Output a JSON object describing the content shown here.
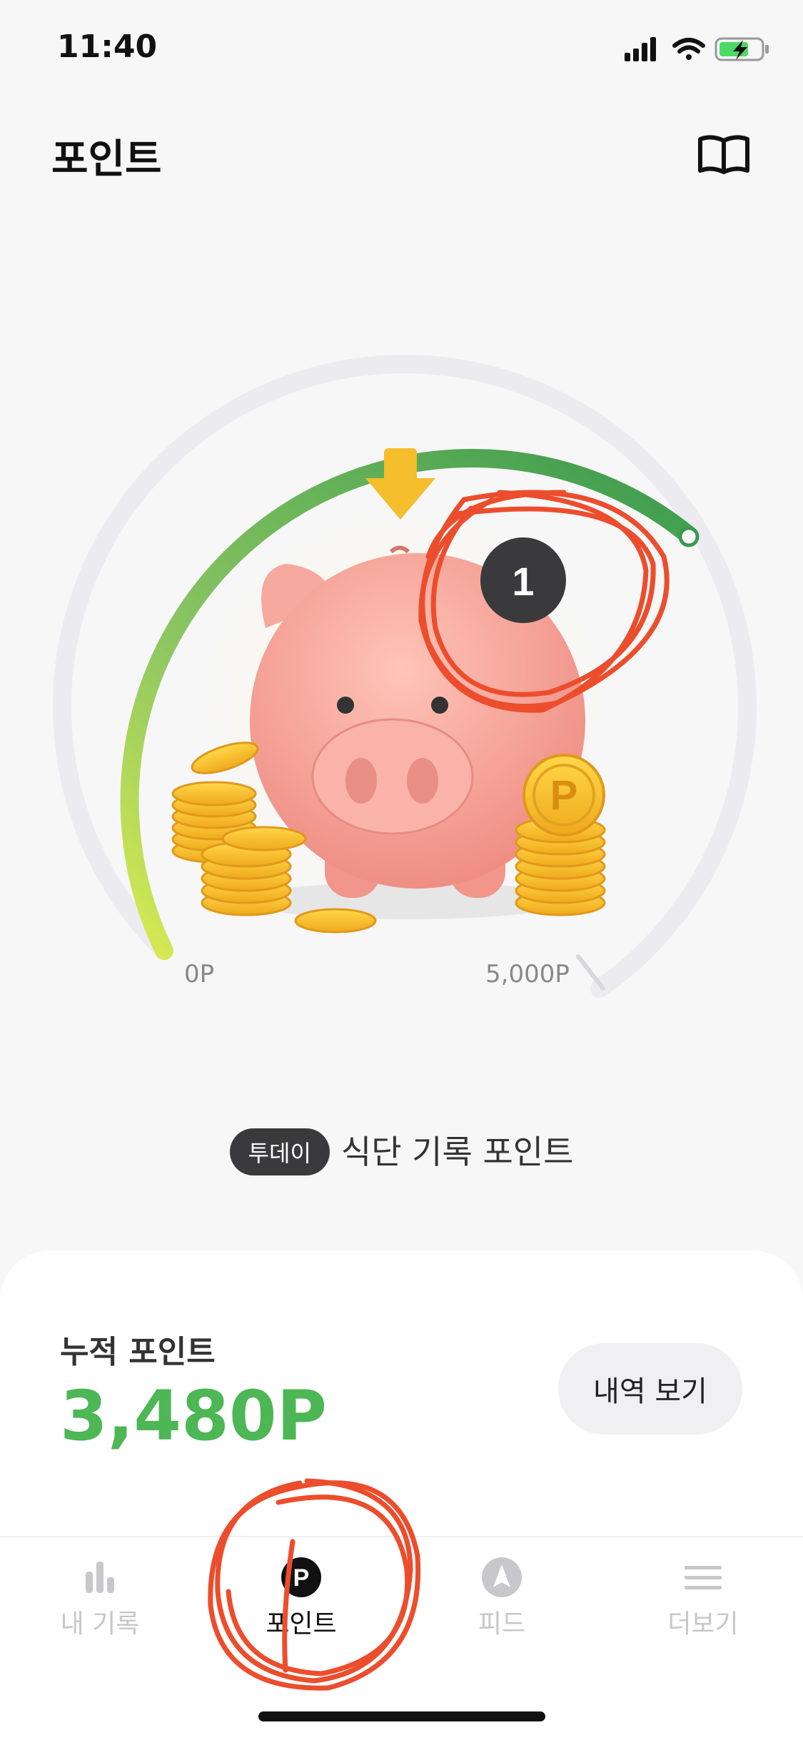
{
  "status_bar": {
    "time": "11:40"
  },
  "header": {
    "title": "포인트",
    "guide_icon": "book-open-icon"
  },
  "gauge": {
    "min_label": "0P",
    "max_label": "5,000P",
    "progress_fraction": 0.7,
    "badge_number": "1",
    "colors": {
      "gradient_start": "#d7ea4a",
      "gradient_end": "#3a9a4e",
      "track": "#ececf0"
    }
  },
  "today": {
    "badge": "투데이",
    "label": "식단 기록 포인트"
  },
  "summary": {
    "label": "누적 포인트",
    "value": "3,480P",
    "history_button": "내역 보기",
    "value_color": "#4db655"
  },
  "tabs": [
    {
      "label": "내 기록",
      "icon": "bar-chart-icon",
      "active": false
    },
    {
      "label": "포인트",
      "icon": "points-p-icon",
      "active": true
    },
    {
      "label": "피드",
      "icon": "compass-icon",
      "active": false
    },
    {
      "label": "더보기",
      "icon": "menu-icon",
      "active": false
    }
  ]
}
